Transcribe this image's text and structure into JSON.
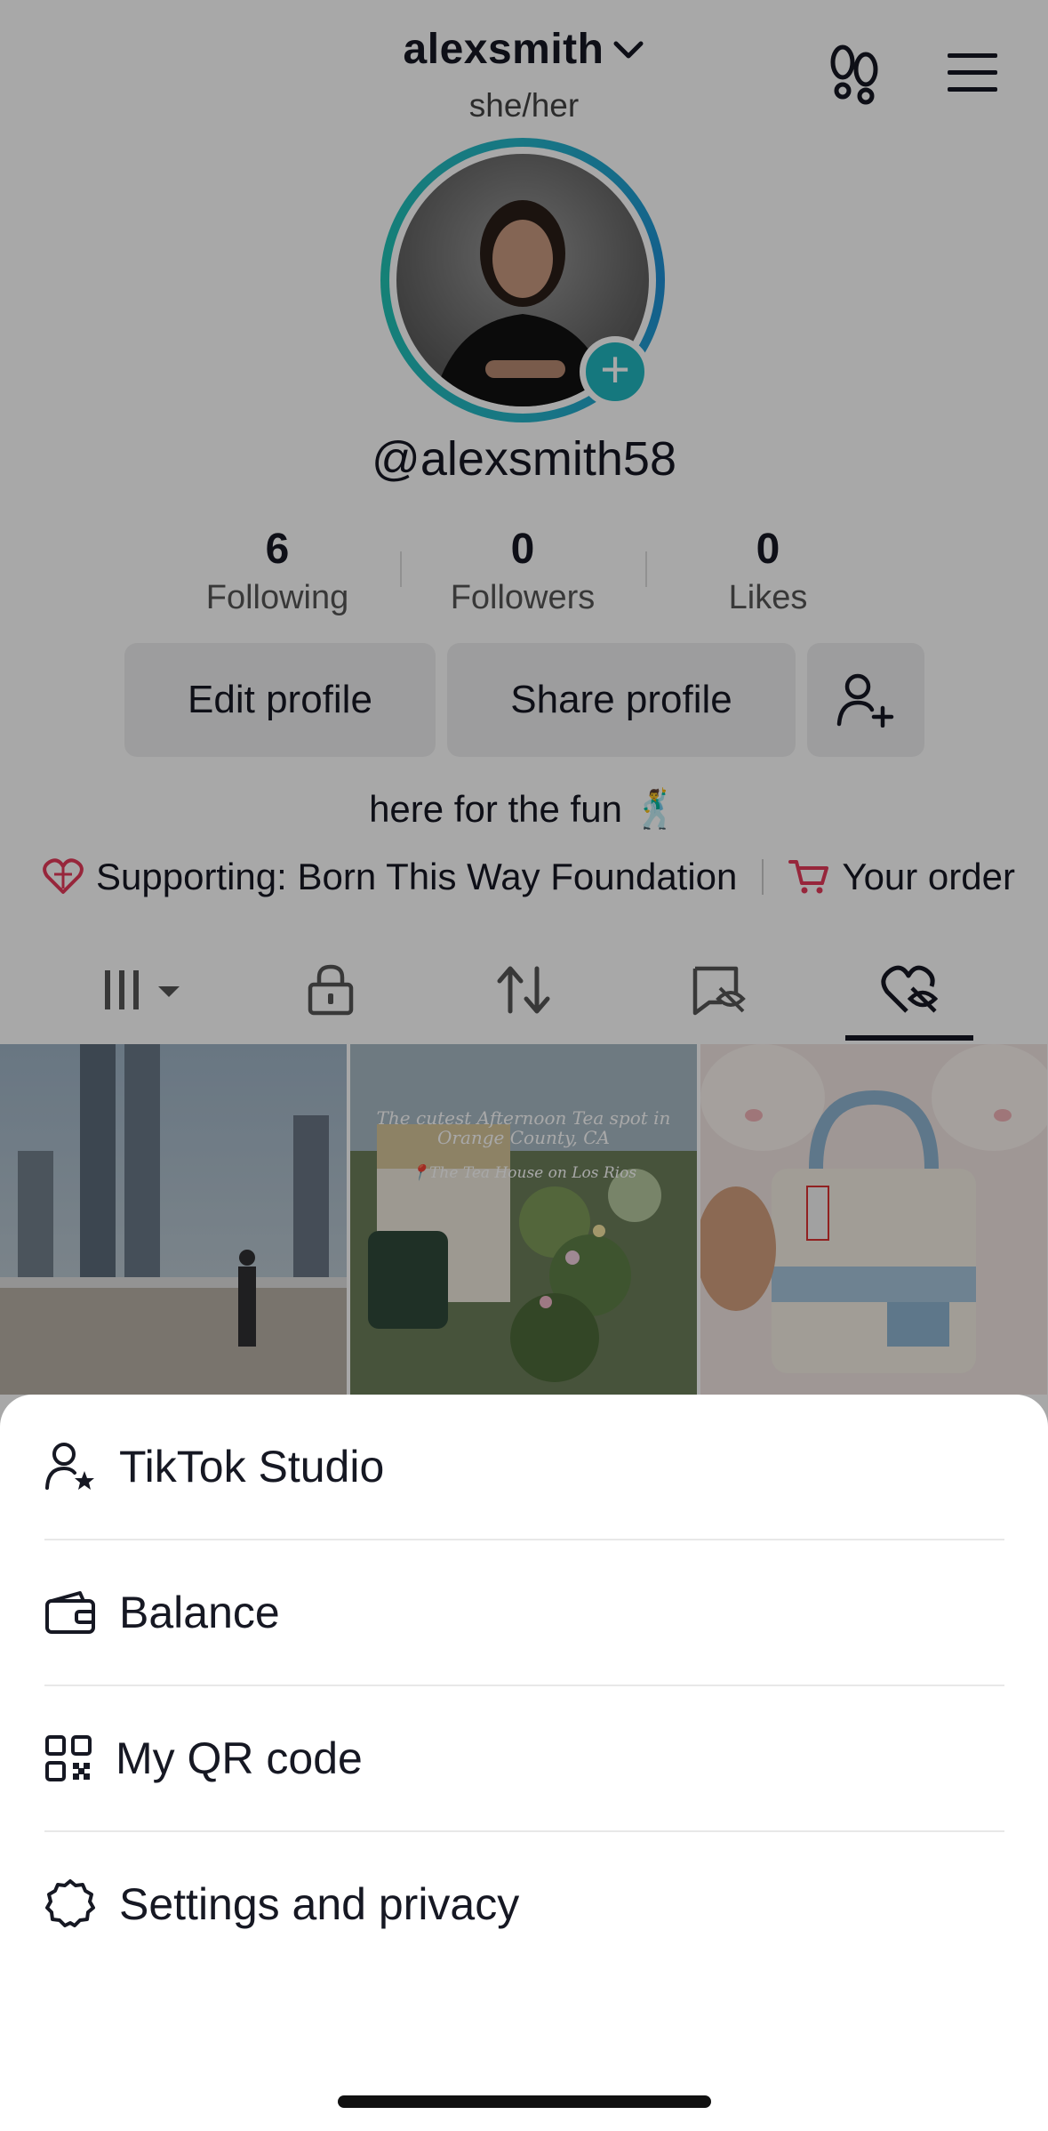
{
  "profile": {
    "username": "alexsmith",
    "pronouns": "she/her",
    "handle": "@alexsmith58",
    "stats": [
      {
        "value": "6",
        "label": "Following"
      },
      {
        "value": "0",
        "label": "Followers"
      },
      {
        "value": "0",
        "label": "Likes"
      }
    ],
    "buttons": {
      "edit": "Edit profile",
      "share": "Share profile"
    },
    "bio": "here for the fun",
    "bio_emoji": "🕺",
    "links": {
      "supporting": "Supporting: Born This Way Foundation",
      "orders": "Your order"
    }
  },
  "tabs": [
    "grid-icon",
    "lock-icon",
    "repost-icon",
    "saved-hidden-icon",
    "liked-hidden-icon"
  ],
  "thumbnails": [
    {
      "caption": ""
    },
    {
      "caption": "The cutest Afternoon Tea spot in Orange County, CA",
      "subcaption": "📍The Tea House on Los Rios"
    },
    {
      "caption": ""
    }
  ],
  "menu": {
    "items": [
      {
        "label": "TikTok Studio",
        "icon": "user-star-icon"
      },
      {
        "label": "Balance",
        "icon": "wallet-icon"
      },
      {
        "label": "My QR code",
        "icon": "qr-code-icon"
      },
      {
        "label": "Settings and privacy",
        "icon": "gear-icon"
      }
    ]
  },
  "colors": {
    "accent": "#20b6c0",
    "link_red": "#e53a5a"
  }
}
